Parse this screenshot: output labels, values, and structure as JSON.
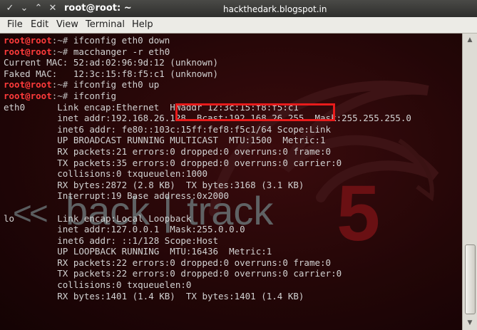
{
  "window": {
    "title": "root@root: ~",
    "watermark": "hackthedark.blogspot.in",
    "controls": {
      "collapse": "✓",
      "minimize": "⌄",
      "maximize": "⌃",
      "close": "✕"
    }
  },
  "menubar": {
    "items": [
      "File",
      "Edit",
      "View",
      "Terminal",
      "Help"
    ]
  },
  "terminal": {
    "lines": [
      {
        "type": "prompt",
        "user": "root@root",
        "path": ":~# ",
        "cmd": "ifconfig eth0 down"
      },
      {
        "type": "prompt",
        "user": "root@root",
        "path": ":~# ",
        "cmd": "macchanger -r eth0"
      },
      {
        "type": "out",
        "text": "Current MAC: 52:ad:02:96:9d:12 (unknown)"
      },
      {
        "type": "out",
        "text": "Faked MAC:   12:3c:15:f8:f5:c1 (unknown)"
      },
      {
        "type": "prompt",
        "user": "root@root",
        "path": ":~# ",
        "cmd": "ifconfig eth0 up"
      },
      {
        "type": "prompt",
        "user": "root@root",
        "path": ":~# ",
        "cmd": "ifconfig"
      },
      {
        "type": "out",
        "text": "eth0      Link encap:Ethernet  HWaddr 12:3c:15:f8:f5:c1"
      },
      {
        "type": "out",
        "text": "          inet addr:192.168.26.128  Bcast:192.168.26.255  Mask:255.255.255.0"
      },
      {
        "type": "out",
        "text": "          inet6 addr: fe80::103c:15ff:fef8:f5c1/64 Scope:Link"
      },
      {
        "type": "out",
        "text": "          UP BROADCAST RUNNING MULTICAST  MTU:1500  Metric:1"
      },
      {
        "type": "out",
        "text": "          RX packets:21 errors:0 dropped:0 overruns:0 frame:0"
      },
      {
        "type": "out",
        "text": "          TX packets:35 errors:0 dropped:0 overruns:0 carrier:0"
      },
      {
        "type": "out",
        "text": "          collisions:0 txqueuelen:1000"
      },
      {
        "type": "out",
        "text": "          RX bytes:2872 (2.8 KB)  TX bytes:3168 (3.1 KB)"
      },
      {
        "type": "out",
        "text": "          Interrupt:19 Base address:0x2000"
      },
      {
        "type": "out",
        "text": ""
      },
      {
        "type": "out",
        "text": "lo        Link encap:Local Loopback"
      },
      {
        "type": "out",
        "text": "          inet addr:127.0.0.1  Mask:255.0.0.0"
      },
      {
        "type": "out",
        "text": "          inet6 addr: ::1/128 Scope:Host"
      },
      {
        "type": "out",
        "text": "          UP LOOPBACK RUNNING  MTU:16436  Metric:1"
      },
      {
        "type": "out",
        "text": "          RX packets:22 errors:0 dropped:0 overruns:0 frame:0"
      },
      {
        "type": "out",
        "text": "          TX packets:22 errors:0 dropped:0 overruns:0 carrier:0"
      },
      {
        "type": "out",
        "text": "          collisions:0 txqueuelen:0"
      },
      {
        "type": "out",
        "text": "          RX bytes:1401 (1.4 KB)  TX bytes:1401 (1.4 KB)"
      }
    ]
  },
  "background_logo": {
    "chevrons": "<<",
    "word_back": "back",
    "bar": "|",
    "word_track": "track",
    "digit": "5"
  },
  "colors": {
    "terminal_bg": "#230607",
    "prompt": "#ff3b3b",
    "text": "#d2d2d2",
    "highlight_border": "#e81b1b"
  }
}
